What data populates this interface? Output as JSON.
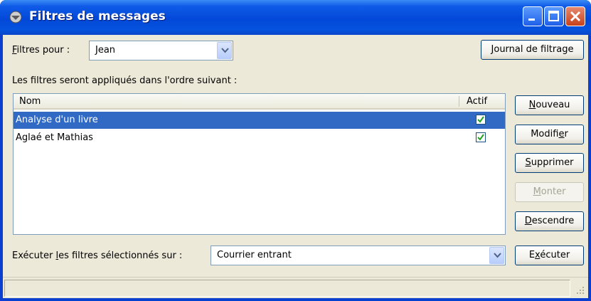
{
  "window": {
    "title": "Filtres de messages"
  },
  "toolbar": {
    "filters_for_label_u": "F",
    "filters_for_label_rest": "iltres pour :",
    "account_value": "Jean",
    "log_button_u": "J",
    "log_button_rest": "ournal de filtrage"
  },
  "order_text": "Les filtres seront appliqués dans l'ordre suivant :",
  "list": {
    "col_name": "Nom",
    "col_active": "Actif",
    "rows": [
      {
        "name": "Analyse d'un livre",
        "active": true,
        "selected": true
      },
      {
        "name": "Aglaé et Mathias",
        "active": true,
        "selected": false
      }
    ]
  },
  "side_buttons": {
    "new_u": "N",
    "new_rest": "ouveau",
    "edit_pre": "Modifi",
    "edit_u": "e",
    "edit_post": "r",
    "delete_u": "S",
    "delete_rest": "upprimer",
    "up_u": "M",
    "up_rest": "onter",
    "down_u": "D",
    "down_rest": "escendre"
  },
  "bottom": {
    "run_label_pre": "Exécuter ",
    "run_label_u": "l",
    "run_label_post": "es filtres sélectionnés sur :",
    "folder_value": "Courrier entrant",
    "exec_pre": "E",
    "exec_u": "x",
    "exec_post": "écuter"
  },
  "colors": {
    "titlebar": "#0348d8",
    "selection": "#316ac5",
    "dialog_bg": "#ece9d8"
  }
}
